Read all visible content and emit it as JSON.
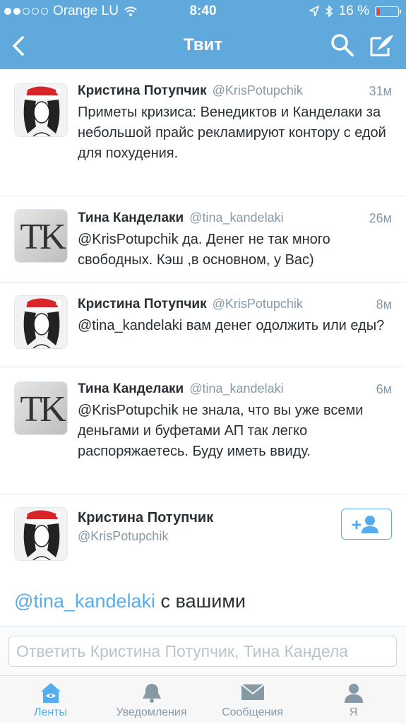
{
  "status_bar": {
    "carrier": "Orange LU",
    "time": "8:40",
    "battery": "16 %"
  },
  "nav": {
    "title": "Твит"
  },
  "colors": {
    "accent": "#55acee",
    "header": "#5fa9dd",
    "muted": "#8899a6",
    "text": "#292f33"
  },
  "tweets": [
    {
      "name": "Кристина Потупчик",
      "handle": "@KrisPotupchik",
      "time": "31м",
      "text": "Приметы кризиса: Венедиктов и Канделаки за небольшой прайс рекламируют контору с едой для похудения."
    },
    {
      "name": "Тина Канделаки",
      "handle": "@tina_kandelaki",
      "time": "26м",
      "text": "@KrisPotupchik да. Денег не так много свободных. Кэш ,в основном, у Вас)"
    },
    {
      "name": "Кристина Потупчик",
      "handle": "@KrisPotupchik",
      "time": "8м",
      "text": "@tina_kandelaki вам денег одолжить или еды?"
    },
    {
      "name": "Тина Канделаки",
      "handle": "@tina_kandelaki",
      "time": "6м",
      "text": "@KrisPotupchik не знала, что вы уже всеми деньгами и буфетами АП так легко распоряжаетесь. Буду иметь ввиду."
    }
  ],
  "detail": {
    "name": "Кристина Потупчик",
    "handle": "@KrisPotupchik",
    "mention": "@tina_kandelaki",
    "text_visible": " с вашими"
  },
  "reply": {
    "placeholder": "Ответить Кристина Потупчик, Тина Кандела"
  },
  "avatars": {
    "tk_initials": "TK"
  },
  "tabs": [
    {
      "label": "Ленты",
      "icon": "home-icon",
      "active": true
    },
    {
      "label": "Уведомления",
      "icon": "bell-icon",
      "active": false
    },
    {
      "label": "Сообщения",
      "icon": "envelope-icon",
      "active": false
    },
    {
      "label": "Я",
      "icon": "person-icon",
      "active": false
    }
  ]
}
